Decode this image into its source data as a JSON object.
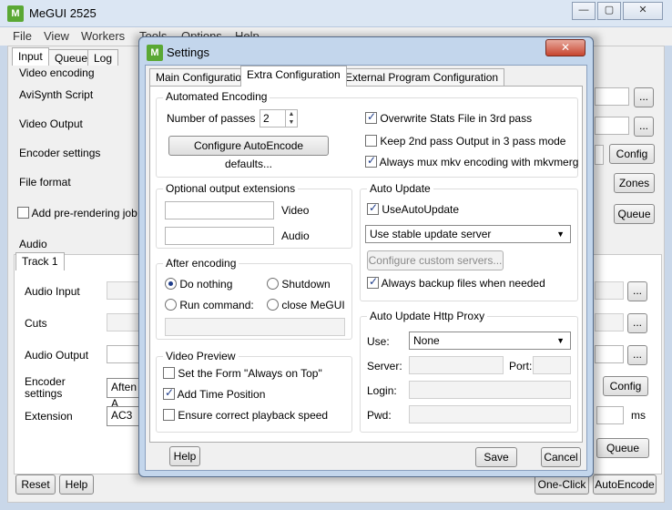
{
  "main": {
    "title": "MeGUI 2525",
    "menu": [
      "File",
      "View",
      "Workers",
      "Tools",
      "Options",
      "Help"
    ],
    "tabs": [
      "Input",
      "Queue",
      "Log"
    ],
    "video_group": "Video encoding",
    "avisynth_label": "AviSynth Script",
    "video_output_label": "Video Output",
    "encoder_settings_label": "Encoder settings",
    "file_format_label": "File format",
    "add_prerender_label": "Add pre-rendering job",
    "config_btn": "Config",
    "zones_btn": "Zones",
    "queue_btn": "Queue",
    "audio_group": "Audio",
    "track_tab": "Track 1",
    "audio_input_label": "Audio Input",
    "cuts_label": "Cuts",
    "audio_output_label": "Audio Output",
    "audio_encoder_label_1": "Encoder",
    "audio_encoder_label_2": "settings",
    "audio_encoder_value": "Aften A",
    "extension_label": "Extension",
    "extension_value": "AC3",
    "audio_config_btn": "Config",
    "ms_label": "ms",
    "audio_queue_btn": "Queue",
    "reset_btn": "Reset",
    "help_btn": "Help",
    "oneclick_btn": "One-Click",
    "autoencode_btn": "AutoEncode",
    "browse": "..."
  },
  "dialog": {
    "title": "Settings",
    "close": "✕",
    "tabs": [
      "Main Configuration",
      "Extra Configuration",
      "External Program Configuration"
    ],
    "automated": {
      "title": "Automated Encoding",
      "passes_label": "Number of passes",
      "passes_value": "2",
      "configure_btn": "Configure AutoEncode defaults...",
      "overwrite_stats": "Overwrite Stats File in 3rd pass",
      "keep_2nd_pass": "Keep 2nd pass Output in 3 pass mode",
      "always_mux": "Always mux mkv encoding with mkvmerge"
    },
    "optional_ext": {
      "title": "Optional output extensions",
      "video_label": "Video",
      "audio_label": "Audio",
      "video_value": "",
      "audio_value": ""
    },
    "after_encoding": {
      "title": "After encoding",
      "do_nothing": "Do nothing",
      "shutdown": "Shutdown",
      "run_command": "Run command:",
      "close_megui": "close MeGUI",
      "command_value": ""
    },
    "video_preview": {
      "title": "Video Preview",
      "always_on_top": "Set the Form \"Always on Top\"",
      "add_time": "Add Time Position",
      "ensure_speed": "Ensure correct playback speed"
    },
    "auto_update": {
      "title": "Auto Update",
      "use_auto_update": "UseAutoUpdate",
      "server_select": "Use stable update server",
      "custom_servers_btn": "Configure custom servers...",
      "always_backup": "Always backup files when needed"
    },
    "proxy": {
      "title": "Auto Update Http Proxy",
      "use_label": "Use:",
      "use_value": "None",
      "server_label": "Server:",
      "port_label": "Port:",
      "login_label": "Login:",
      "pwd_label": "Pwd:"
    },
    "help_btn": "Help",
    "save_btn": "Save",
    "cancel_btn": "Cancel"
  }
}
